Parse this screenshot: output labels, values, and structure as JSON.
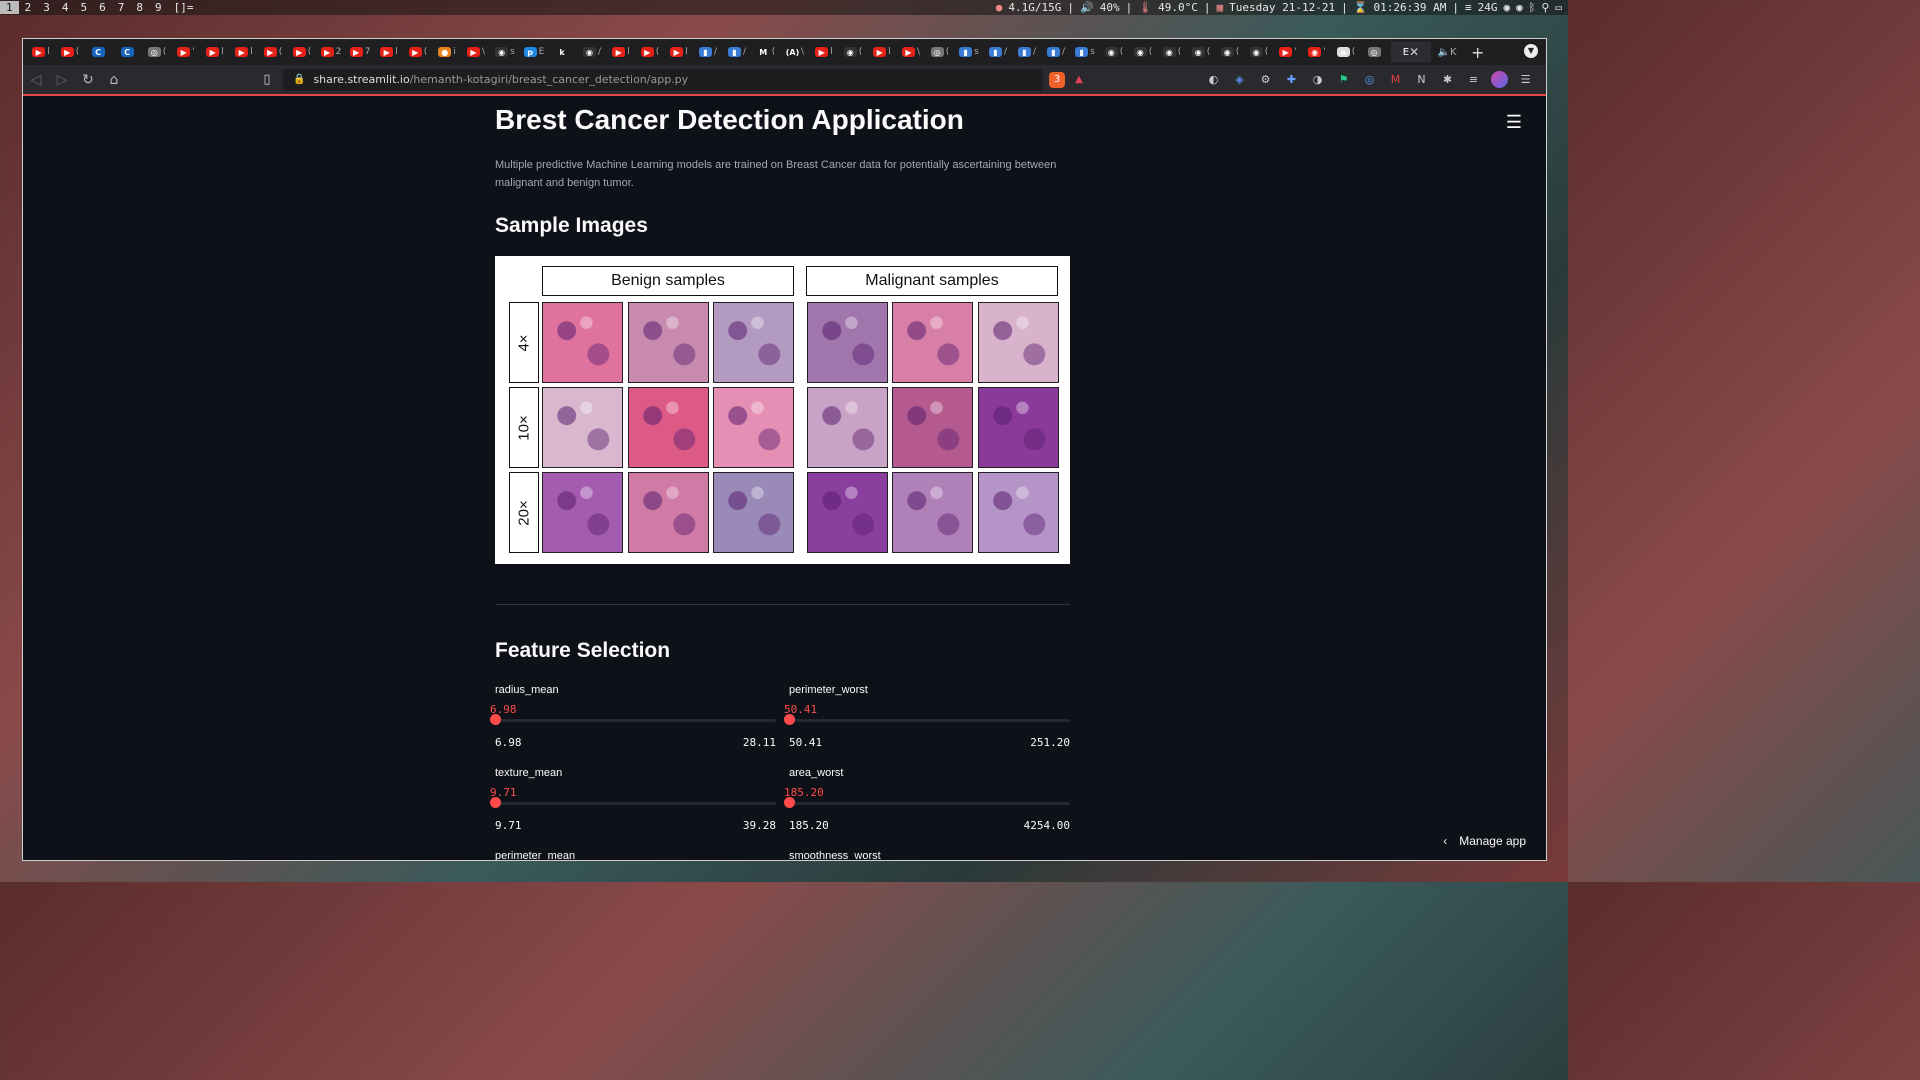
{
  "desktop": {
    "workspaces": [
      "1",
      "2",
      "3",
      "4",
      "5",
      "6",
      "7",
      "8",
      "9",
      "[]="
    ],
    "active_workspace": 0,
    "status": {
      "memory": "4.1G/15G",
      "volume": "40%",
      "temperature": "49.0°C",
      "date": "Tuesday 21-12-21",
      "time": "01:26:39 AM",
      "disk": "24G"
    }
  },
  "browser": {
    "url_host": "share.streamlit.io",
    "url_path": "/hemanth-kotagiri/breast_cancer_detection/app.py",
    "shields_count": "3",
    "tabs": [
      {
        "icon": "youtube-icon",
        "color": "#e62117",
        "glyph": "▶",
        "sep": "l"
      },
      {
        "icon": "youtube-icon",
        "color": "#e62117",
        "glyph": "▶",
        "sep": "("
      },
      {
        "icon": "c-icon",
        "color": "#1565c0",
        "glyph": "C",
        "sep": ""
      },
      {
        "icon": "c-icon",
        "color": "#1565c0",
        "glyph": "C",
        "sep": ""
      },
      {
        "icon": "globe-icon",
        "color": "#777777",
        "glyph": "◎",
        "sep": "("
      },
      {
        "icon": "youtube-icon",
        "color": "#e62117",
        "glyph": "▶",
        "sep": "'"
      },
      {
        "icon": "youtube-icon",
        "color": "#e62117",
        "glyph": "▶",
        "sep": "l"
      },
      {
        "icon": "youtube-icon",
        "color": "#e62117",
        "glyph": "▶",
        "sep": "l"
      },
      {
        "icon": "youtube-icon",
        "color": "#e62117",
        "glyph": "▶",
        "sep": "("
      },
      {
        "icon": "youtube-icon",
        "color": "#e62117",
        "glyph": "▶",
        "sep": "("
      },
      {
        "icon": "youtube-icon",
        "color": "#e62117",
        "glyph": "▶",
        "sep": "2"
      },
      {
        "icon": "youtube-icon",
        "color": "#e62117",
        "glyph": "▶",
        "sep": "7"
      },
      {
        "icon": "youtube-icon",
        "color": "#e62117",
        "glyph": "▶",
        "sep": "l"
      },
      {
        "icon": "youtube-icon",
        "color": "#e62117",
        "glyph": "▶",
        "sep": "("
      },
      {
        "icon": "firefox-icon",
        "color": "#e8821e",
        "glyph": "●",
        "sep": "i"
      },
      {
        "icon": "youtube-icon",
        "color": "#e62117",
        "glyph": "▶",
        "sep": "\\"
      },
      {
        "icon": "github-icon",
        "color": "#333333",
        "glyph": "◉",
        "sep": "s"
      },
      {
        "icon": "p-icon",
        "color": "#1e88e5",
        "glyph": "p",
        "sep": "E"
      },
      {
        "icon": "k-icon",
        "color": "#1f1f22",
        "glyph": "k",
        "sep": ""
      },
      {
        "icon": "github-icon",
        "color": "#333333",
        "glyph": "◉",
        "sep": "/"
      },
      {
        "icon": "youtube-icon",
        "color": "#e62117",
        "glyph": "▶",
        "sep": "l"
      },
      {
        "icon": "youtube-icon",
        "color": "#e62117",
        "glyph": "▶",
        "sep": "("
      },
      {
        "icon": "youtube-icon",
        "color": "#e62117",
        "glyph": "▶",
        "sep": "l"
      },
      {
        "icon": "stack-icon",
        "color": "#3a7bd5",
        "glyph": "▮",
        "sep": "/"
      },
      {
        "icon": "stack-icon",
        "color": "#3a7bd5",
        "glyph": "▮",
        "sep": "/"
      },
      {
        "icon": "gmail-icon",
        "color": "#1f1f22",
        "glyph": "M",
        "sep": "("
      },
      {
        "icon": "a-icon",
        "color": "#1f1f22",
        "glyph": "(A)",
        "sep": "\\"
      },
      {
        "icon": "youtube-icon",
        "color": "#e62117",
        "glyph": "▶",
        "sep": "l"
      },
      {
        "icon": "github-icon",
        "color": "#333333",
        "glyph": "◉",
        "sep": "("
      },
      {
        "icon": "youtube-icon",
        "color": "#e62117",
        "glyph": "▶",
        "sep": "l"
      },
      {
        "icon": "youtube-icon",
        "color": "#e62117",
        "glyph": "▶",
        "sep": "\\"
      },
      {
        "icon": "globe-icon",
        "color": "#777777",
        "glyph": "◎",
        "sep": "("
      },
      {
        "icon": "stack-icon",
        "color": "#3a7bd5",
        "glyph": "▮",
        "sep": "s"
      },
      {
        "icon": "stack-icon",
        "color": "#3a7bd5",
        "glyph": "▮",
        "sep": "/"
      },
      {
        "icon": "stack-icon",
        "color": "#3a7bd5",
        "glyph": "▮",
        "sep": "/"
      },
      {
        "icon": "stack-icon",
        "color": "#3a7bd5",
        "glyph": "▮",
        "sep": "/"
      },
      {
        "icon": "stack-icon",
        "color": "#3a7bd5",
        "glyph": "▮",
        "sep": "s"
      },
      {
        "icon": "github-icon",
        "color": "#333333",
        "glyph": "◉",
        "sep": "("
      },
      {
        "icon": "github-icon",
        "color": "#333333",
        "glyph": "◉",
        "sep": "("
      },
      {
        "icon": "github-icon",
        "color": "#333333",
        "glyph": "◉",
        "sep": "("
      },
      {
        "icon": "github-icon",
        "color": "#333333",
        "glyph": "◉",
        "sep": "("
      },
      {
        "icon": "github-icon",
        "color": "#333333",
        "glyph": "◉",
        "sep": "("
      },
      {
        "icon": "github-icon",
        "color": "#333333",
        "glyph": "◉",
        "sep": "("
      },
      {
        "icon": "youtube-icon",
        "color": "#e62117",
        "glyph": "▶",
        "sep": "'"
      },
      {
        "icon": "record-icon",
        "color": "#e62117",
        "glyph": "◉",
        "sep": "'"
      },
      {
        "icon": "amazon-icon",
        "color": "#dddddd",
        "glyph": "a",
        "sep": "("
      },
      {
        "icon": "globe-icon",
        "color": "#777777",
        "glyph": "◎",
        "sep": ""
      }
    ],
    "active_tab_label": "E",
    "speaker_tab_label": "K"
  },
  "app": {
    "title": "Brest Cancer Detection Application",
    "description": "Multiple predictive Machine Learning models are trained on Breast Cancer data for potentially ascertaining between malignant and benign tumor.",
    "sample_images_heading": "Sample Images",
    "figure": {
      "group_labels": [
        "Benign samples",
        "Malignant samples"
      ],
      "row_labels": [
        "4×",
        "10×",
        "20×"
      ],
      "tile_colors": [
        [
          "#e0739e",
          "#c88aaf",
          "#b39ac0",
          "#a076ac",
          "#d87fa8",
          "#d9b2cc"
        ],
        [
          "#d9b8cf",
          "#de5a86",
          "#e58fb4",
          "#c9a3c6",
          "#b45a8e",
          "#8a3a9a"
        ],
        [
          "#a45cb0",
          "#d07aa6",
          "#9a8ab8",
          "#8a3e9e",
          "#b080b8",
          "#b594c8"
        ]
      ]
    },
    "feature_heading": "Feature Selection",
    "sliders": [
      {
        "label": "radius_mean",
        "value": "6.98",
        "min": "6.98",
        "max": "28.11",
        "fraction": 0
      },
      {
        "label": "perimeter_worst",
        "value": "50.41",
        "min": "50.41",
        "max": "251.20",
        "fraction": 0
      },
      {
        "label": "texture_mean",
        "value": "9.71",
        "min": "9.71",
        "max": "39.28",
        "fraction": 0
      },
      {
        "label": "area_worst",
        "value": "185.20",
        "min": "185.20",
        "max": "4254.00",
        "fraction": 0
      },
      {
        "label": "perimeter_mean",
        "value": "",
        "min": "",
        "max": "",
        "fraction": 0
      },
      {
        "label": "smoothness_worst",
        "value": "",
        "min": "",
        "max": "",
        "fraction": 0
      }
    ],
    "manage_app": "Manage app"
  }
}
